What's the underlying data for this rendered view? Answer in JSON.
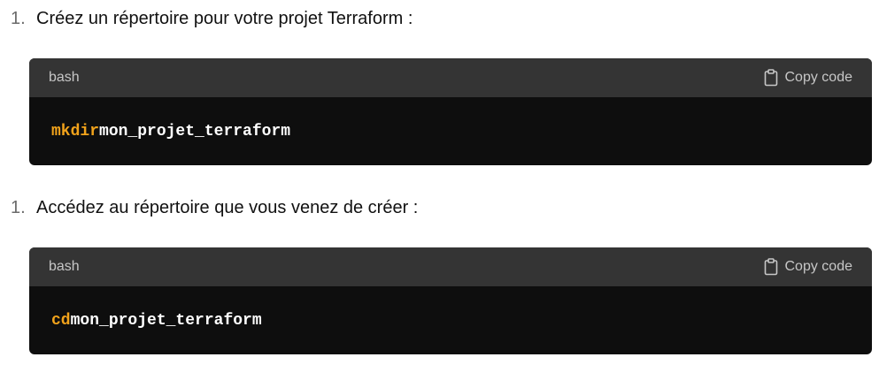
{
  "steps": [
    {
      "number": "1.",
      "text": "Créez un répertoire pour votre projet Terraform :",
      "code": {
        "language": "bash",
        "copy_label": "Copy code",
        "command": "mkdir",
        "argument": "mon_projet_terraform"
      }
    },
    {
      "number": "1.",
      "text": "Accédez au répertoire que vous venez de créer :",
      "code": {
        "language": "bash",
        "copy_label": "Copy code",
        "command": "cd",
        "argument": "mon_projet_terraform"
      }
    }
  ],
  "icons": {
    "copy": "clipboard-icon"
  },
  "colors": {
    "header_bg": "#343434",
    "code_bg": "#0e0e0e",
    "keyword": "#f2a31b",
    "text": "#ffffff"
  }
}
